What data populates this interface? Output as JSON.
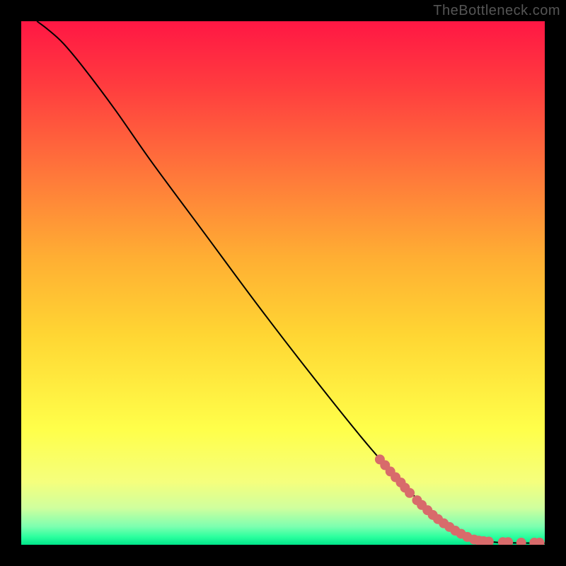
{
  "watermark": "TheBottleneck.com",
  "chart_data": {
    "type": "line",
    "title": "",
    "xlabel": "",
    "ylabel": "",
    "xlim": [
      0,
      100
    ],
    "ylim": [
      0,
      100
    ],
    "gradient_stops": [
      {
        "offset": 0.0,
        "color": "#ff1744"
      },
      {
        "offset": 0.12,
        "color": "#ff3b3f"
      },
      {
        "offset": 0.3,
        "color": "#ff7a3a"
      },
      {
        "offset": 0.45,
        "color": "#ffae33"
      },
      {
        "offset": 0.6,
        "color": "#ffd633"
      },
      {
        "offset": 0.78,
        "color": "#ffff4a"
      },
      {
        "offset": 0.88,
        "color": "#f5ff7d"
      },
      {
        "offset": 0.93,
        "color": "#cfff9e"
      },
      {
        "offset": 0.965,
        "color": "#7dffb0"
      },
      {
        "offset": 0.985,
        "color": "#2bff9e"
      },
      {
        "offset": 1.0,
        "color": "#00e58a"
      }
    ],
    "curve": [
      {
        "x": 3.0,
        "y": 100.0
      },
      {
        "x": 5.0,
        "y": 98.5
      },
      {
        "x": 8.0,
        "y": 95.8
      },
      {
        "x": 12.0,
        "y": 91.0
      },
      {
        "x": 18.0,
        "y": 83.0
      },
      {
        "x": 25.0,
        "y": 73.0
      },
      {
        "x": 35.0,
        "y": 59.5
      },
      {
        "x": 45.0,
        "y": 46.0
      },
      {
        "x": 55.0,
        "y": 33.0
      },
      {
        "x": 65.0,
        "y": 20.5
      },
      {
        "x": 72.0,
        "y": 12.5
      },
      {
        "x": 78.0,
        "y": 6.5
      },
      {
        "x": 82.0,
        "y": 3.3
      },
      {
        "x": 85.0,
        "y": 1.6
      },
      {
        "x": 88.0,
        "y": 0.8
      },
      {
        "x": 92.0,
        "y": 0.4
      },
      {
        "x": 100.0,
        "y": 0.3
      }
    ],
    "markers": [
      {
        "x": 68.5,
        "y": 16.3
      },
      {
        "x": 69.5,
        "y": 15.2
      },
      {
        "x": 70.5,
        "y": 14.0
      },
      {
        "x": 71.5,
        "y": 12.9
      },
      {
        "x": 72.5,
        "y": 11.9
      },
      {
        "x": 73.3,
        "y": 10.9
      },
      {
        "x": 74.2,
        "y": 9.9
      },
      {
        "x": 75.6,
        "y": 8.5
      },
      {
        "x": 76.5,
        "y": 7.6
      },
      {
        "x": 77.6,
        "y": 6.6
      },
      {
        "x": 78.6,
        "y": 5.7
      },
      {
        "x": 79.6,
        "y": 4.9
      },
      {
        "x": 80.7,
        "y": 4.1
      },
      {
        "x": 81.8,
        "y": 3.4
      },
      {
        "x": 82.9,
        "y": 2.7
      },
      {
        "x": 84.0,
        "y": 2.1
      },
      {
        "x": 85.2,
        "y": 1.5
      },
      {
        "x": 86.5,
        "y": 1.0
      },
      {
        "x": 87.4,
        "y": 0.8
      },
      {
        "x": 88.3,
        "y": 0.7
      },
      {
        "x": 89.3,
        "y": 0.6
      },
      {
        "x": 92.0,
        "y": 0.5
      },
      {
        "x": 93.0,
        "y": 0.5
      },
      {
        "x": 95.5,
        "y": 0.4
      },
      {
        "x": 98.0,
        "y": 0.4
      },
      {
        "x": 99.0,
        "y": 0.4
      }
    ],
    "marker_style": {
      "fill": "#d86b6b",
      "r": 7
    },
    "line_style": {
      "stroke": "#000000",
      "width": 2
    }
  }
}
